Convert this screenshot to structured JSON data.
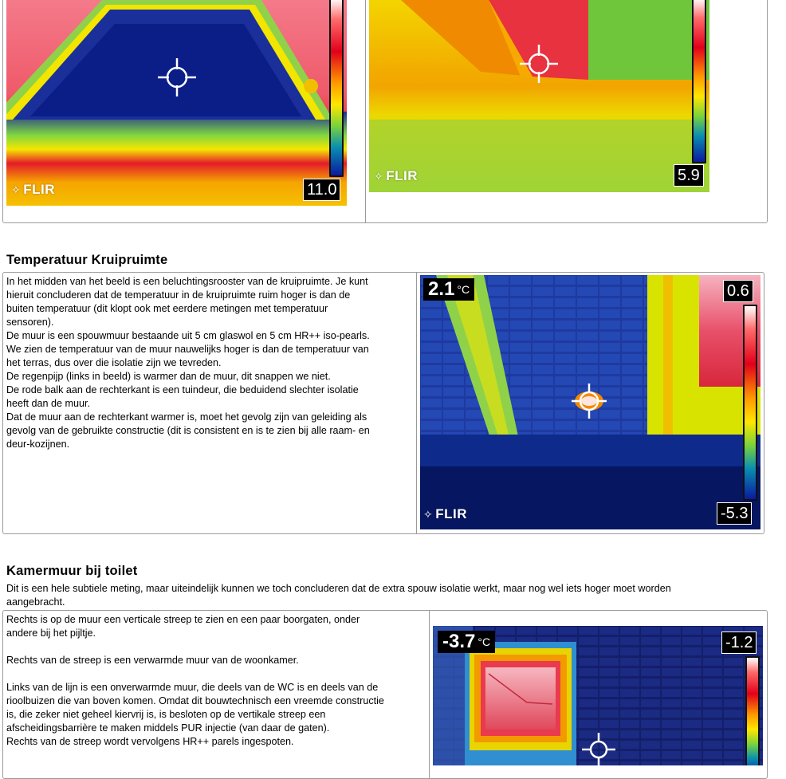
{
  "section1": {
    "image_left": {
      "logo": "FLIR",
      "scale_min": "11.0"
    },
    "image_right": {
      "logo": "FLIR",
      "scale_min": "5.9"
    }
  },
  "section2": {
    "title": "Temperatuur  Kruipruimte",
    "lines": [
      "In het midden van het beeld is een beluchtingsrooster van de kruipruimte. Je kunt",
      "hieruit concluderen dat de temperatuur in de kruipruimte ruim hoger is dan de",
      "buiten temperatuur (dit klopt ook met eerdere metingen met temperatuur",
      "sensoren).",
      "De muur is  een spouwmuur bestaande uit 5  cm glaswol  en 5 cm HR++ iso-pearls.",
      "We zien de temperatuur van de muur nauwelijks hoger is dan de temperatuur van",
      "het terras, dus over die isolatie  zijn  we tevreden.",
      "De regenpijp (links in beeld) is warmer dan de muur, dit snappen we niet.",
      "De rode balk aan  de rechterkant is een tuindeur, die beduidend slechter isolatie",
      "heeft dan de muur.",
      "Dat de muur aan  de rechterkant warmer is,  moet het gevolg zijn van geleiding als",
      "gevolg van de gebruikte constructie (dit is  consistent en is  te zien bij alle raam-  en",
      "deur-kozijnen."
    ],
    "image": {
      "spot_temp": "2.1",
      "spot_unit": "°C",
      "scale_max": "0.6",
      "scale_min": "-5.3",
      "logo": "FLIR"
    }
  },
  "section3": {
    "title": "Kamermuur  bij toilet",
    "intro_lines": [
      "Dit is  een hele subtiele meting, maar uiteindelijk kunnen we toch concluderen dat de extra spouw isolatie  werkt, maar nog wel iets hoger moet worden",
      "aangebracht."
    ],
    "lines": [
      "Rechts is  op de  muur een verticale streep te zien en een paar boorgaten, onder",
      "andere bij het pijltje.",
      "",
      "Rechts van de streep is  een verwarmde muur van de woonkamer.",
      "",
      "Links van de lijn  is een onverwarmde muur, die deels van de WC is  en deels van de",
      "rioolbuizen die van boven komen. Omdat dit bouwtechnisch een vreemde constructie",
      "is, die zeker niet geheel kiervrij is,  is  besloten op de vertikale streep een",
      "afscheidingsbarrière  te maken middels PUR injectie (van daar  de gaten).",
      "Rechts van de streep wordt vervolgens HR++ parels  ingespoten."
    ],
    "image": {
      "spot_temp": "-3.7",
      "spot_unit": "°C",
      "scale_max": "-1.2"
    }
  }
}
